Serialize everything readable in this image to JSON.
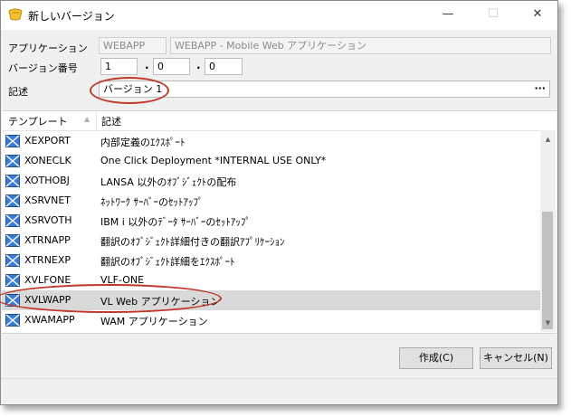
{
  "window": {
    "title": "新しいバージョン",
    "minimize_glyph": "—",
    "maximize_glyph": "☐",
    "close_glyph": "✕"
  },
  "form": {
    "application_label": "アプリケーション",
    "application_code": "WEBAPP",
    "application_name": "WEBAPP - Mobile Web アプリケーション",
    "version_label": "バージョン番号",
    "version_major": "1",
    "version_minor": "0",
    "version_patch": "0",
    "version_separator": ".",
    "description_label": "記述",
    "description_value": "バージョン 1",
    "description_button": "···"
  },
  "grid": {
    "columns": [
      "テンプレート",
      "記述"
    ],
    "rows": [
      {
        "name": "XEXPORT",
        "desc": "内部定義のｴｸｽﾎﾟｰﾄ"
      },
      {
        "name": "XONECLK",
        "desc": "One Click Deployment *INTERNAL USE ONLY*"
      },
      {
        "name": "XOTHOBJ",
        "desc": "LANSA 以外のｵﾌﾞｼﾞｪｸﾄの配布"
      },
      {
        "name": "XSRVNET",
        "desc": "ﾈｯﾄﾜｰｸ ｻｰﾊﾞｰのｾｯﾄｱｯﾌﾟ"
      },
      {
        "name": "XSRVOTH",
        "desc": "IBM i 以外のﾃﾞｰﾀ ｻｰﾊﾞｰのｾｯﾄｱｯﾌﾟ"
      },
      {
        "name": "XTRNAPP",
        "desc": "翻訳のｵﾌﾞｼﾞｪｸﾄ詳細付きの翻訳ｱﾌﾟﾘｹｰｼｮﾝ"
      },
      {
        "name": "XTRNEXP",
        "desc": "翻訳のｵﾌﾞｼﾞｪｸﾄ詳細をｴｸｽﾎﾟｰﾄ"
      },
      {
        "name": "XVLFONE",
        "desc": "VLF-ONE"
      },
      {
        "name": "XVLWAPP",
        "desc": "VL Web アプリケーション"
      },
      {
        "name": "XWAMAPP",
        "desc": "WAM アプリケーション"
      }
    ],
    "selected_row": "XVLWAPP",
    "scroll_up_glyph": "▲",
    "scroll_down_glyph": "▼"
  },
  "buttons": {
    "create": "作成(C)",
    "cancel": "キャンセル(N)"
  },
  "colors": {
    "annotation": "#c0392b",
    "selected_row": "#d9d9d9",
    "icon_blue": "#2b6cb0"
  }
}
